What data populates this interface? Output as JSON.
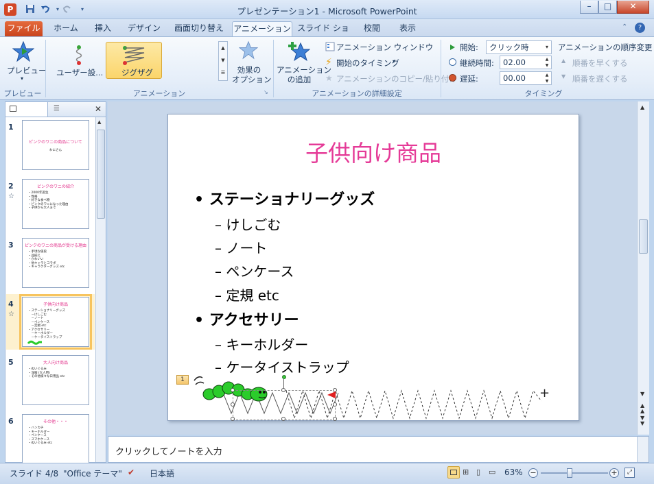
{
  "window": {
    "app_icon": "P",
    "title": "プレゼンテーション1 - Microsoft PowerPoint",
    "minimize": "–",
    "maximize": "□",
    "close": "✕"
  },
  "quick_access": {
    "save_icon": "save-icon",
    "undo_icon": "undo-icon",
    "redo_icon": "redo-icon"
  },
  "tabs": [
    {
      "label": "ファイル"
    },
    {
      "label": "ホーム"
    },
    {
      "label": "挿入"
    },
    {
      "label": "デザイン"
    },
    {
      "label": "画面切り替え"
    },
    {
      "label": "アニメーション"
    },
    {
      "label": "スライド ショー"
    },
    {
      "label": "校閲"
    },
    {
      "label": "表示"
    }
  ],
  "active_tab": "アニメーション",
  "ribbon": {
    "preview": {
      "button": "プレビュー",
      "group": "プレビュー"
    },
    "animation": {
      "items": [
        "ユーザー設...",
        "ジグザグ"
      ],
      "selected": "ジグザグ",
      "effect_options": "効果の\nオプション",
      "group": "アニメーション"
    },
    "advanced": {
      "add_animation": "アニメーション\nの追加",
      "animation_pane": "アニメーション ウィンドウ",
      "trigger": "開始のタイミング",
      "painter": "アニメーションのコピー/貼り付け",
      "group": "アニメーションの詳細設定"
    },
    "timing": {
      "start_label": "開始:",
      "start_value": "クリック時",
      "duration_label": "継続時間:",
      "duration_value": "02.00",
      "delay_label": "遅延:",
      "delay_value": "00.00",
      "group": "タイミング",
      "reorder_title": "アニメーションの順序変更",
      "move_earlier": "順番を早くする",
      "move_later": "順番を遅くする"
    }
  },
  "thumbnails": [
    {
      "num": "1",
      "title": "ピンクのワニの商品について",
      "lines": [
        "わにさん"
      ],
      "has_anim": false
    },
    {
      "num": "2",
      "title": "ピンクのワニの紹介",
      "lines": [
        "・2000年誕生",
        "・性格",
        "・好きな食べ物",
        "・ピンクのワニになった理由",
        "・子供から大人まで"
      ],
      "has_anim": true
    },
    {
      "num": "3",
      "title": "ピンクのワニの商品が受ける理由",
      "lines": [
        "・手頃な値段",
        "・品揃え",
        "・かわいい",
        "・他キャラとコラボ",
        "・キャラクターグッズ etc"
      ],
      "has_anim": false
    },
    {
      "num": "4",
      "title": "子供向け商品",
      "lines": [
        "・ステーショナリーグッズ",
        "　－けしごむ",
        "　－ノート",
        "　－ペンケース",
        "　－定規 etc",
        "・アクセサリー",
        "　－キーホルダー",
        "　－ケータイストラップ"
      ],
      "has_anim": true
    },
    {
      "num": "5",
      "title": "大人向け商品",
      "lines": [
        "・ぬいぐるみ",
        "・洋服 (大人用)",
        "・その他様々な日用品 etc"
      ],
      "has_anim": false
    },
    {
      "num": "6",
      "title": "その他・・・",
      "lines": [
        "・ハンカチ",
        "・キーホルダー",
        "・ペンケース",
        "・スマホケース",
        "・ぬいぐるみ etc"
      ],
      "has_anim": false
    }
  ],
  "slide": {
    "title": "子供向け商品",
    "bullets": [
      {
        "level": 1,
        "text": "• ステーショナリーグッズ"
      },
      {
        "level": 2,
        "text": "– けしごむ"
      },
      {
        "level": 2,
        "text": "– ノート"
      },
      {
        "level": 2,
        "text": "– ペンケース"
      },
      {
        "level": 2,
        "text": "– 定規 etc"
      },
      {
        "level": 1,
        "text": "• アクセサリー"
      },
      {
        "level": 2,
        "text": "– キーホルダー"
      },
      {
        "level": 2,
        "text": "– ケータイストラップ"
      }
    ],
    "anim_tag": "1"
  },
  "notes_placeholder": "クリックしてノートを入力",
  "status": {
    "slide": "スライド 4/8",
    "theme": "\"Office テーマ\"",
    "language": "日本語",
    "zoom": "63%",
    "zoom_fraction": 0.43
  }
}
